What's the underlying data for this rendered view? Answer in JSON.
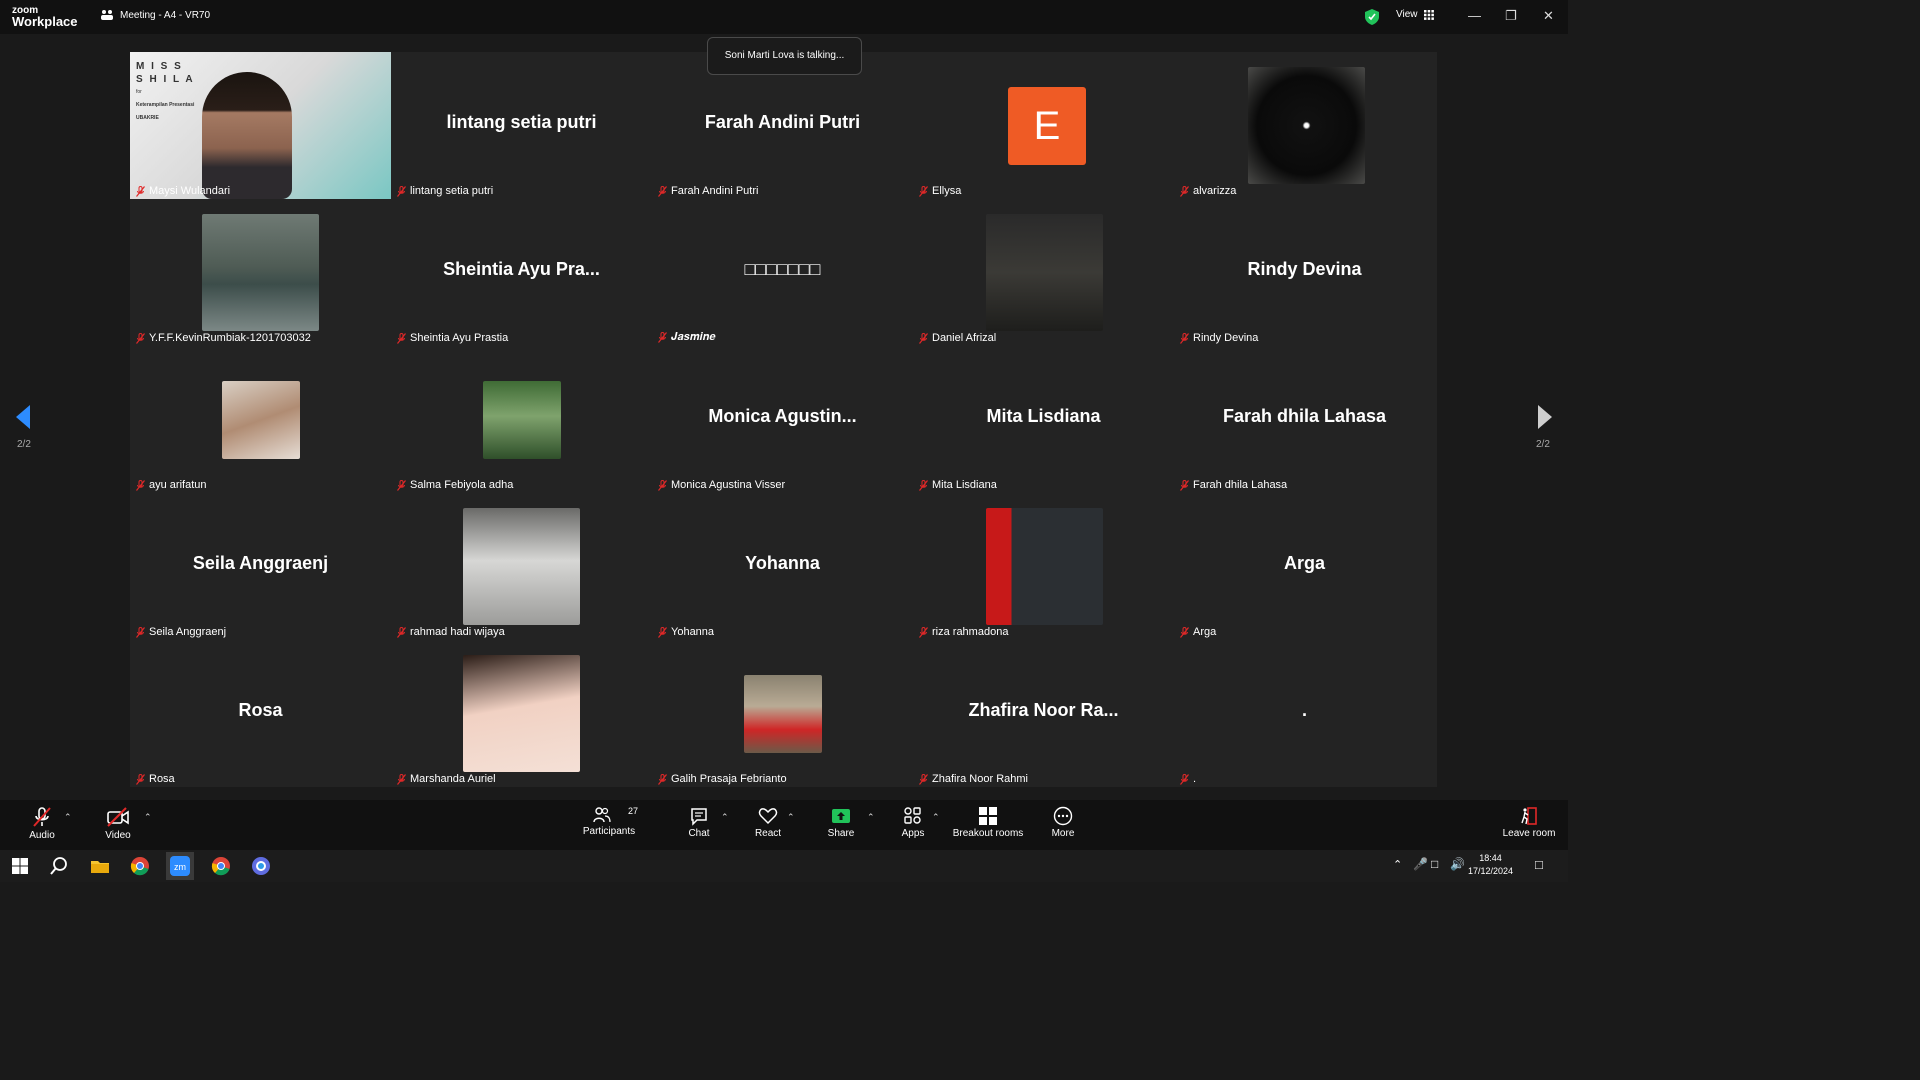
{
  "window": {
    "app_brand_top": "zoom",
    "app_brand_bottom": "Workplace",
    "meeting_title": "Meeting - A4 - VR70",
    "view_label": "View"
  },
  "notification": "Soni Marti Lova is talking...",
  "pagination": {
    "left": "2/2",
    "right": "2/2"
  },
  "tiles": [
    {
      "big": "",
      "label": "Maysi Wulandari",
      "media": "video"
    },
    {
      "big": "lintang setia putri",
      "label": "lintang setia putri",
      "media": "none"
    },
    {
      "big": "Farah Andini Putri",
      "label": "Farah Andini Putri",
      "media": "none"
    },
    {
      "big": "",
      "label": "Ellysa",
      "media": "avatar",
      "avatar_letter": "E"
    },
    {
      "big": "",
      "label": "alvarizza",
      "media": "photo"
    },
    {
      "big": "",
      "label": "Y.F.F.KevinRumbiak-1201703032",
      "media": "photo"
    },
    {
      "big": "Sheintia Ayu Pra...",
      "label": "Sheintia Ayu Prastia",
      "media": "none"
    },
    {
      "big": "□□□□□□□",
      "label": "𝑱𝒂𝒔𝒎𝒊𝒏𝒆",
      "media": "none"
    },
    {
      "big": "",
      "label": "Daniel Afrizal",
      "media": "photo"
    },
    {
      "big": "Rindy Devina",
      "label": "Rindy Devina",
      "media": "none"
    },
    {
      "big": "",
      "label": "ayu arifatun",
      "media": "photo"
    },
    {
      "big": "",
      "label": "Salma Febiyola adha",
      "media": "photo"
    },
    {
      "big": "Monica Agustin...",
      "label": "Monica Agustina Visser",
      "media": "none"
    },
    {
      "big": "Mita Lisdiana",
      "label": "Mita Lisdiana",
      "media": "none"
    },
    {
      "big": "Farah dhila Lahasa",
      "label": "Farah dhila Lahasa",
      "media": "none"
    },
    {
      "big": "Seila Anggraenj",
      "label": "Seila Anggraenj",
      "media": "none"
    },
    {
      "big": "",
      "label": "rahmad hadi wijaya",
      "media": "photo"
    },
    {
      "big": "Yohanna",
      "label": "Yohanna",
      "media": "none"
    },
    {
      "big": "",
      "label": "riza rahmadona",
      "media": "photo"
    },
    {
      "big": "Arga",
      "label": "Arga",
      "media": "none"
    },
    {
      "big": "Rosa",
      "label": "Rosa",
      "media": "none"
    },
    {
      "big": "",
      "label": "Marshanda Auriel",
      "media": "photo"
    },
    {
      "big": "",
      "label": "Galih Prasaja Febrianto",
      "media": "photo"
    },
    {
      "big": "Zhafira Noor Ra...",
      "label": "Zhafira Noor Rahmi",
      "media": "none"
    },
    {
      "big": ".",
      "label": ".",
      "media": "none"
    }
  ],
  "video_overlay": {
    "line1": "M I S S",
    "line2": "S H I L A",
    "line3": "for",
    "line4": "Keterampilan Presentasi",
    "line5": "UBAKRIE"
  },
  "toolbar": {
    "audio": "Audio",
    "video": "Video",
    "participants": "Participants",
    "participants_count": "27",
    "chat": "Chat",
    "react": "React",
    "share": "Share",
    "apps": "Apps",
    "breakout": "Breakout rooms",
    "more": "More",
    "leave": "Leave room"
  },
  "taskbar": {
    "time": "18:44",
    "date": "17/12/2024"
  },
  "colors": {
    "accent": "#2d8cff",
    "share_green": "#21c35a",
    "avatar_orange": "#ef5b25",
    "muted_red": "#e02828"
  }
}
